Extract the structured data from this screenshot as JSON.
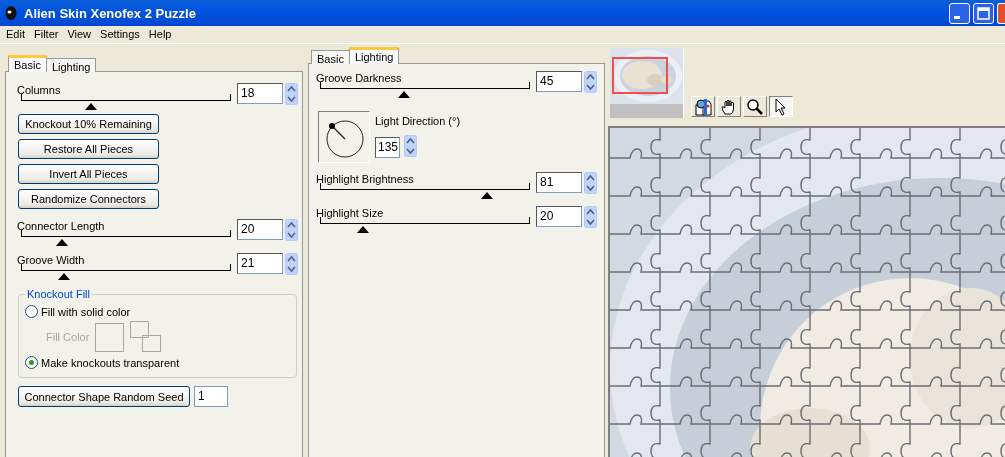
{
  "window": {
    "title": "Alien Skin Xenofex 2 Puzzle"
  },
  "menu": [
    "Edit",
    "Filter",
    "View",
    "Settings",
    "Help"
  ],
  "basic_panel": {
    "tabs": [
      {
        "label": "Basic",
        "selected": true
      },
      {
        "label": "Lighting",
        "selected": false
      }
    ],
    "columns": {
      "label": "Columns",
      "value": "18",
      "level": 0.33
    },
    "buttons": [
      "Knockout 10% Remaining",
      "Restore All Pieces",
      "Invert All Pieces",
      "Randomize Connectors"
    ],
    "sliders": [
      {
        "label": "Connector Length",
        "value": "20",
        "level": 0.19
      },
      {
        "label": "Groove Width",
        "value": "21",
        "level": 0.2
      }
    ],
    "knockout_fill": {
      "title": "Knockout Fill",
      "fill_color_label": "Fill Color",
      "fill_color_disabled": true,
      "options": [
        {
          "label": "Fill with solid color",
          "selected": false
        },
        {
          "label": "Make knockouts transparent",
          "selected": true
        }
      ]
    },
    "seed": {
      "button": "Connector Shape Random Seed",
      "value": "1"
    }
  },
  "lighting_panel": {
    "tabs": [
      {
        "label": "Basic",
        "selected": false
      },
      {
        "label": "Lighting",
        "selected": true
      }
    ],
    "groove_darkness": {
      "label": "Groove Darkness",
      "value": "45",
      "level": 0.4
    },
    "light_direction": {
      "label": "Light Direction (°)",
      "value": "135"
    },
    "sliders": [
      {
        "label": "Highlight Brightness",
        "value": "81",
        "level": 0.8
      },
      {
        "label": "Highlight Size",
        "value": "20",
        "level": 0.2
      }
    ]
  },
  "tools": [
    {
      "kind": "compare",
      "selected": false
    },
    {
      "kind": "pan",
      "selected": false
    },
    {
      "kind": "zoom",
      "selected": false
    },
    {
      "kind": "pointer",
      "selected": true
    }
  ]
}
